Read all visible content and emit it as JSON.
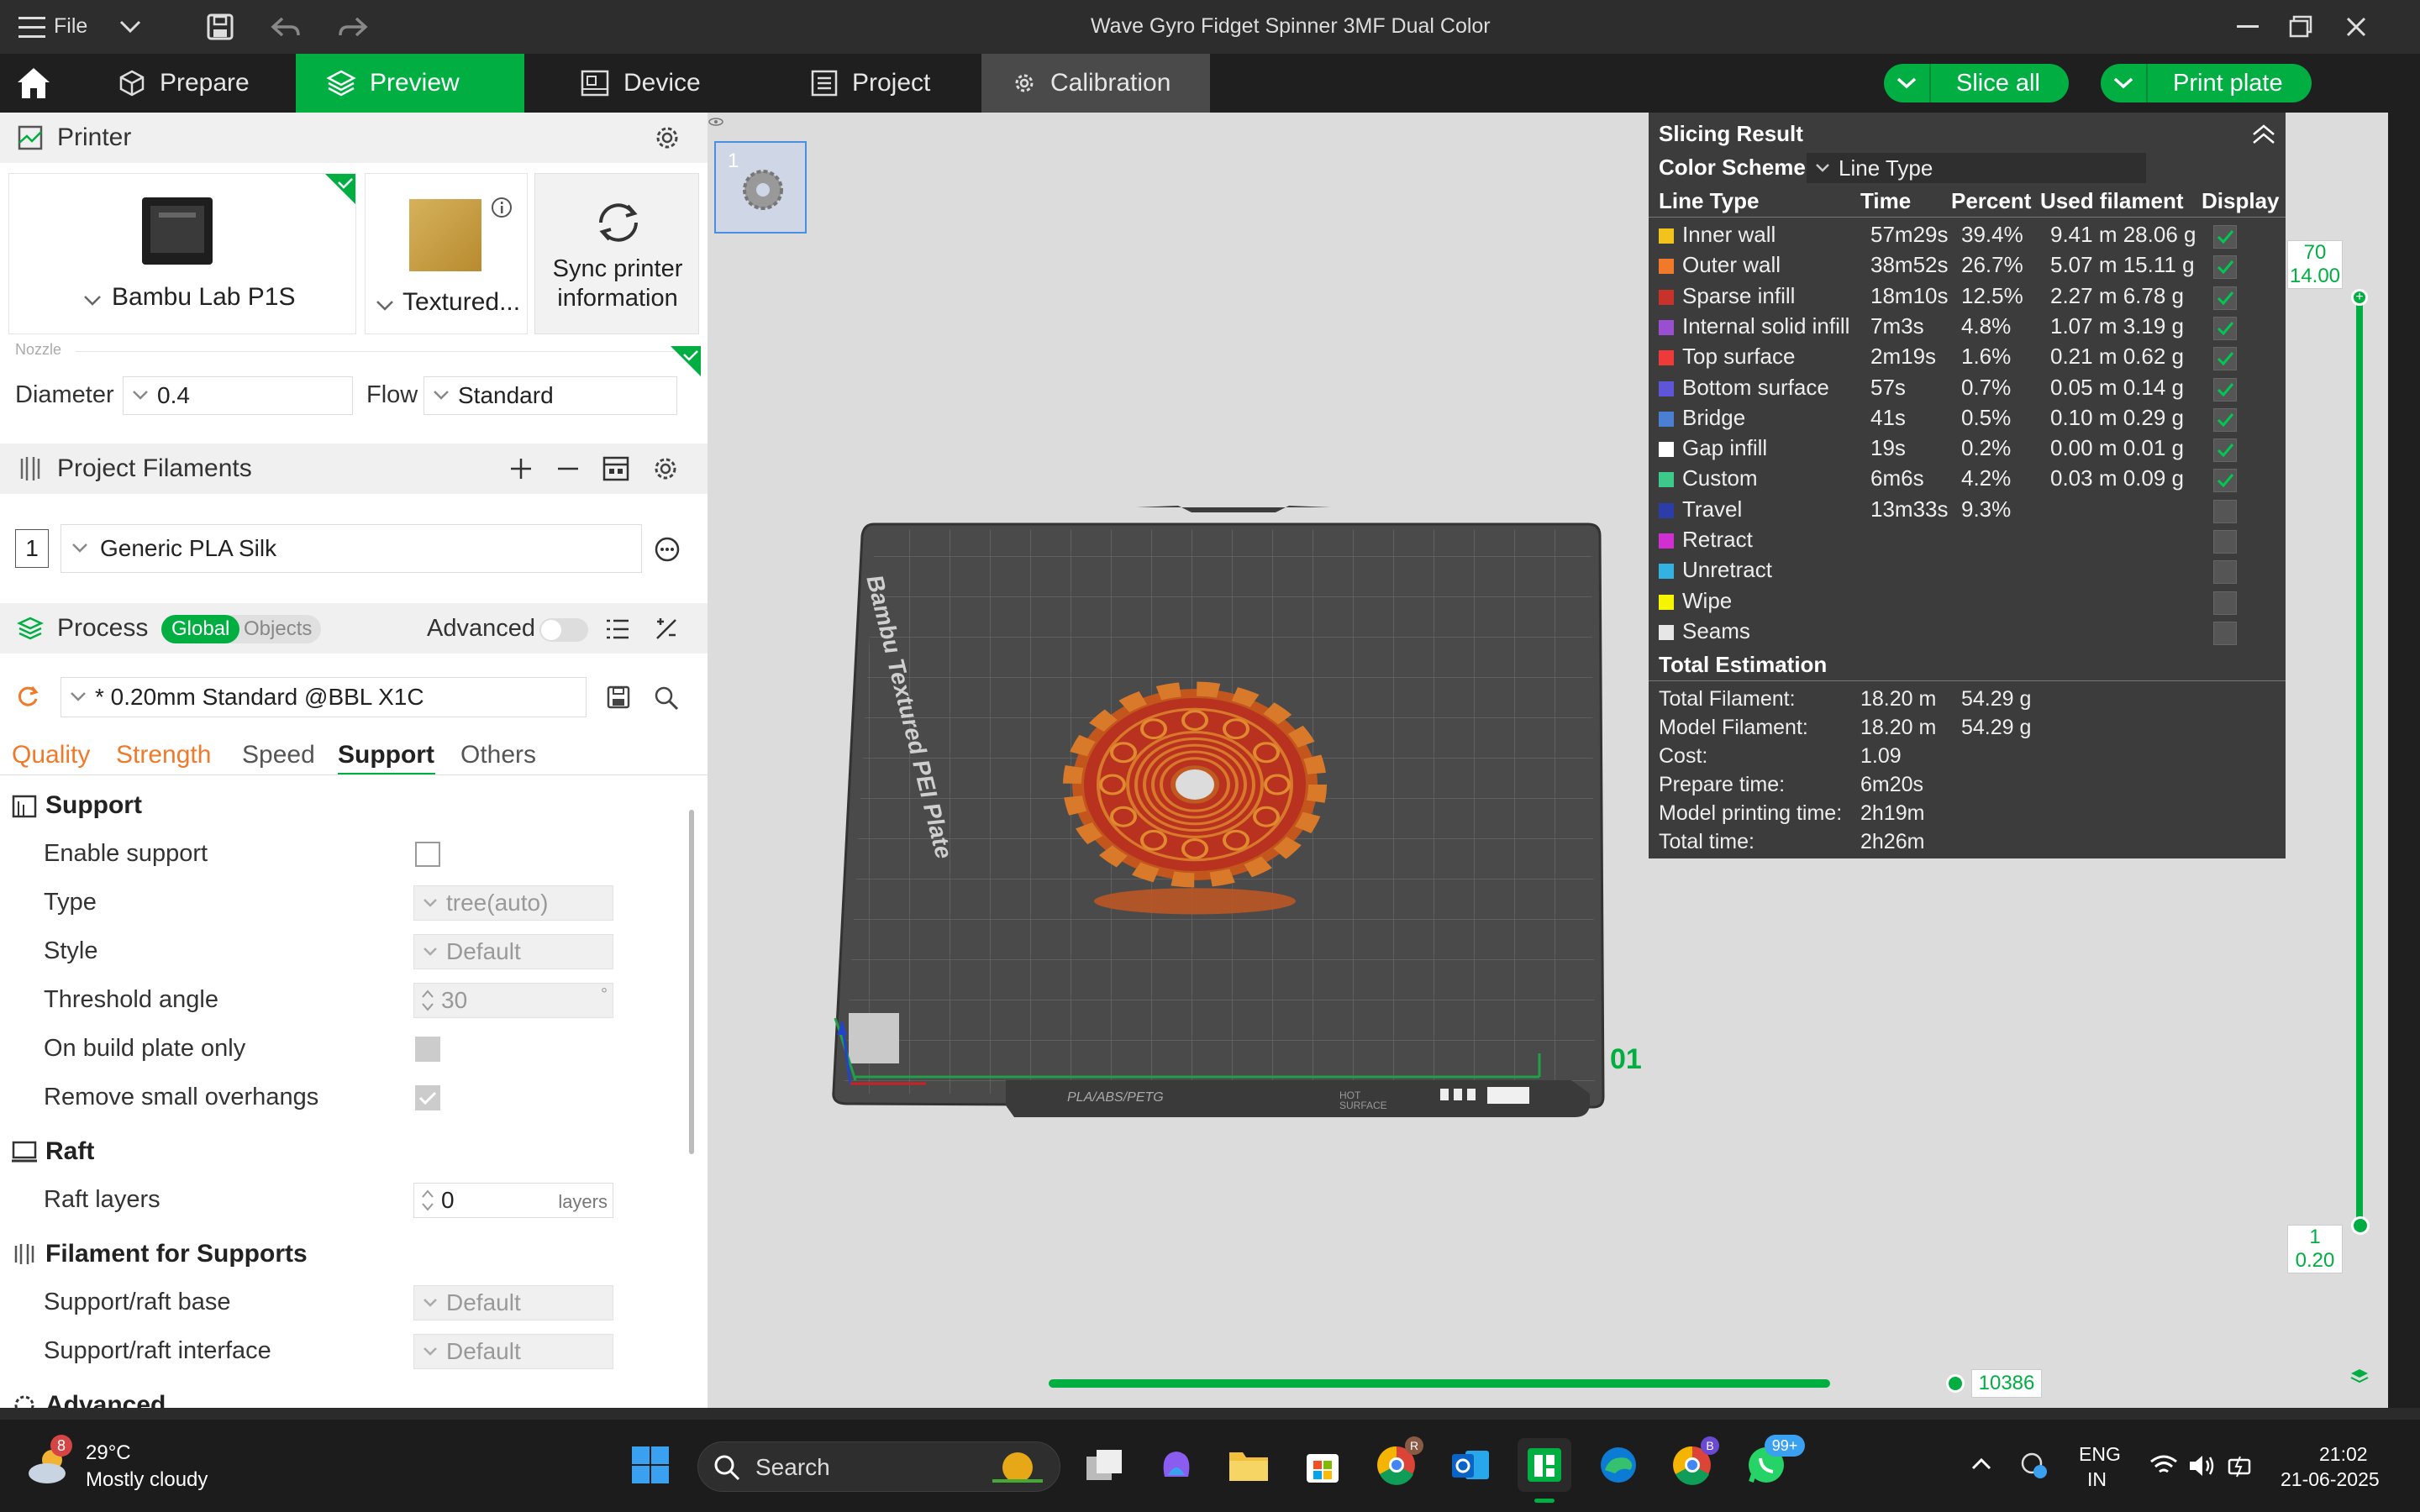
{
  "window": {
    "title": "Wave Gyro Fidget Spinner 3MF Dual Color",
    "file_menu": "File"
  },
  "tabs": [
    {
      "label": "Prepare"
    },
    {
      "label": "Preview"
    },
    {
      "label": "Device"
    },
    {
      "label": "Project"
    },
    {
      "label": "Calibration"
    }
  ],
  "actions": {
    "slice_all": "Slice all",
    "print_plate": "Print plate"
  },
  "printer": {
    "section_title": "Printer",
    "name": "Bambu Lab P1S",
    "plate": "Textured...",
    "sync": "Sync printer information",
    "nozzle_label": "Nozzle",
    "diameter_label": "Diameter",
    "diameter_value": "0.4",
    "flow_label": "Flow",
    "flow_value": "Standard"
  },
  "filaments": {
    "section_title": "Project Filaments",
    "items": [
      {
        "index": "1",
        "name": "Generic PLA Silk"
      }
    ]
  },
  "process": {
    "section_title": "Process",
    "toggle_global": "Global",
    "toggle_objects": "Objects",
    "advanced_label": "Advanced",
    "preset": "* 0.20mm Standard @BBL X1C",
    "subtabs": [
      "Quality",
      "Strength",
      "Speed",
      "Support",
      "Others"
    ],
    "active_subtab": "Support"
  },
  "support": {
    "group_title": "Support",
    "enable_support": "Enable support",
    "type_label": "Type",
    "type_value": "tree(auto)",
    "style_label": "Style",
    "style_value": "Default",
    "threshold_label": "Threshold angle",
    "threshold_value": "30",
    "threshold_unit": "°",
    "build_plate_only": "On build plate only",
    "remove_small": "Remove small overhangs"
  },
  "raft": {
    "group_title": "Raft",
    "layers_label": "Raft layers",
    "layers_value": "0",
    "layers_unit": "layers"
  },
  "filament_supports": {
    "group_title": "Filament for Supports",
    "base_label": "Support/raft base",
    "base_value": "Default",
    "interface_label": "Support/raft interface",
    "interface_value": "Default"
  },
  "advanced_group": "Advanced",
  "plate": {
    "label": "Bambu Textured PEI Plate",
    "bottom_label": "PLA/ABS/PETG",
    "hot_label": "HOT SURFACE",
    "number": "01",
    "thumb_number": "1"
  },
  "layer_slider": {
    "top_layer": "70",
    "top_height": "14.00",
    "bottom_layer": "1",
    "bottom_height": "0.20"
  },
  "move_slider": {
    "value": "10386"
  },
  "slicing_result": {
    "title": "Slicing Result",
    "color_scheme_label": "Color Scheme",
    "color_scheme_value": "Line Type",
    "columns": [
      "Line Type",
      "Time",
      "Percent",
      "Used filament",
      "Display"
    ],
    "rows": [
      {
        "name": "Inner wall",
        "time": "57m29s",
        "percent": "39.4%",
        "used": "9.41 m  28.06 g",
        "color": "#f2c31c",
        "display": true
      },
      {
        "name": "Outer wall",
        "time": "38m52s",
        "percent": "26.7%",
        "used": "5.07 m  15.11 g",
        "color": "#f07a2a",
        "display": true
      },
      {
        "name": "Sparse infill",
        "time": "18m10s",
        "percent": "12.5%",
        "used": "2.27 m  6.78 g",
        "color": "#c7332b",
        "display": true
      },
      {
        "name": "Internal solid infill",
        "time": "7m3s",
        "percent": "4.8%",
        "used": "1.07 m  3.19 g",
        "color": "#9a4ed0",
        "display": true
      },
      {
        "name": "Top surface",
        "time": "2m19s",
        "percent": "1.6%",
        "used": "0.21 m  0.62 g",
        "color": "#ef3a3a",
        "display": true
      },
      {
        "name": "Bottom surface",
        "time": "57s",
        "percent": "0.7%",
        "used": "0.05 m  0.14 g",
        "color": "#5e56d6",
        "display": true
      },
      {
        "name": "Bridge",
        "time": "41s",
        "percent": "0.5%",
        "used": "0.10 m  0.29 g",
        "color": "#4b7fd1",
        "display": true
      },
      {
        "name": "Gap infill",
        "time": "19s",
        "percent": "0.2%",
        "used": "0.00 m  0.01 g",
        "color": "#ffffff",
        "display": true
      },
      {
        "name": "Custom",
        "time": "6m6s",
        "percent": "4.2%",
        "used": "0.03 m  0.09 g",
        "color": "#3cc98a",
        "display": true
      },
      {
        "name": "Travel",
        "time": "13m33s",
        "percent": "9.3%",
        "used": "",
        "color": "#2b3ea8",
        "display": false
      },
      {
        "name": "Retract",
        "time": "",
        "percent": "",
        "used": "",
        "color": "#d12fd1",
        "display": false
      },
      {
        "name": "Unretract",
        "time": "",
        "percent": "",
        "used": "",
        "color": "#33b1e0",
        "display": false
      },
      {
        "name": "Wipe",
        "time": "",
        "percent": "",
        "used": "",
        "color": "#f5f500",
        "display": false
      },
      {
        "name": "Seams",
        "time": "",
        "percent": "",
        "used": "",
        "color": "#e6e6e6",
        "display": false
      }
    ],
    "total_title": "Total Estimation",
    "totals": [
      {
        "label": "Total Filament:",
        "value": "18.20 m",
        "extra": "54.29 g"
      },
      {
        "label": "Model Filament:",
        "value": "18.20 m",
        "extra": "54.29 g"
      },
      {
        "label": "Cost:",
        "value": "1.09",
        "extra": ""
      },
      {
        "label": "Prepare time:",
        "value": "6m20s",
        "extra": ""
      },
      {
        "label": "Model printing time:",
        "value": "2h19m",
        "extra": ""
      },
      {
        "label": "Total time:",
        "value": "2h26m",
        "extra": ""
      }
    ]
  },
  "taskbar": {
    "weather_temp": "29°C",
    "weather_desc": "Mostly cloudy",
    "weather_badge": "8",
    "search": "Search",
    "chrome_badge": "R",
    "chrome2_badge": "B",
    "whatsapp_badge": "99+",
    "lang1": "ENG",
    "lang2": "IN",
    "time": "21:02",
    "date": "21-06-2025"
  }
}
